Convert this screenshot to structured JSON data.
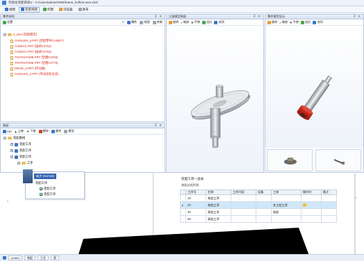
{
  "window": {
    "title": "可视化装配系统V - C:\\Users\\admin\\PME\\frame_hoffs\\3-asm.xhsf"
  },
  "menubar": {
    "items": [
      {
        "label": "视图",
        "icon": "view-icon",
        "color": "#3a78c8"
      },
      {
        "label": "装配视图",
        "icon": "assembly-view-icon",
        "color": "#3a78c8"
      },
      {
        "label": "作图",
        "icon": "draw-icon",
        "color": "#4aa64a"
      },
      {
        "label": "浏览器",
        "icon": "browser-icon",
        "color": "#e89a2b"
      },
      {
        "label": "发布",
        "icon": "publish-icon",
        "color": "#9aa4b1"
      }
    ]
  },
  "product_panel": {
    "title": "零件结构",
    "toolbar_left": "设置",
    "toolbar_items": [
      "属性",
      "绘图",
      "关联"
    ],
    "root": "2_asm (装配模型)",
    "children": [
      "CHISUEN_4.PRT (装配零件CH4807)",
      "TUNDAC.PRT (轴承C0752)",
      "TUNDAC.PRT (轴承C0754)",
      "TOHTAHTIME.PRT (垫圈C0765)",
      "TOHTAHTIME.PRT (垫圈C0775)",
      "DRIVE_2.PRT (传动轴)",
      "CHISUEN_2.PRT (传动齿轮总成)"
    ]
  },
  "view_left": {
    "title": "三维模型装配"
  },
  "view_right": {
    "title": "零件模型显示"
  },
  "view_toolbar": [
    "旋转",
    "缩放",
    "平移",
    "适应",
    "选项"
  ],
  "process_panel": {
    "title": "装配",
    "toolbar": [
      "Ctrl",
      "上移",
      "下移",
      "删除",
      "属性",
      "模型"
    ],
    "root": "装配路线",
    "nodes": [
      "装配工序",
      "装配工序",
      "装配工序",
      "工步"
    ],
    "popup_label": "新步 (Normal)",
    "popup_children": [
      "装配工序",
      "装配工序",
      "装配工序"
    ]
  },
  "process_table": {
    "section_title": "装配工序一览表",
    "caption": "装配过程列表",
    "columns": [
      "工序号",
      "名称",
      "工序内容",
      "设备",
      "工装",
      "操作时",
      "备注"
    ],
    "rows": [
      {
        "no": "10",
        "name": "装配工序",
        "content": "",
        "equipment": "",
        "fixture": "",
        "time": "",
        "note": ""
      },
      {
        "no": "20",
        "name": "装配工序",
        "content": "",
        "equipment": "",
        "fixture": "非工程工序",
        "time": "",
        "note": ""
      },
      {
        "no": "30",
        "name": "装配工序",
        "content": "",
        "equipment": "",
        "fixture": "装配",
        "time": "",
        "note": ""
      },
      {
        "no": "40",
        "name": "装配工序",
        "content": "",
        "equipment": "",
        "fixture": "",
        "time": "",
        "note": ""
      }
    ],
    "footer_label": "工步清单"
  },
  "statusbar": {
    "tabs": [
      "nosten",
      "装配",
      "工艺",
      "视"
    ]
  },
  "colors": {
    "accent": "#3a78c8",
    "tree_highlight": "#d92a1c",
    "selection": "#cfe7f7"
  }
}
